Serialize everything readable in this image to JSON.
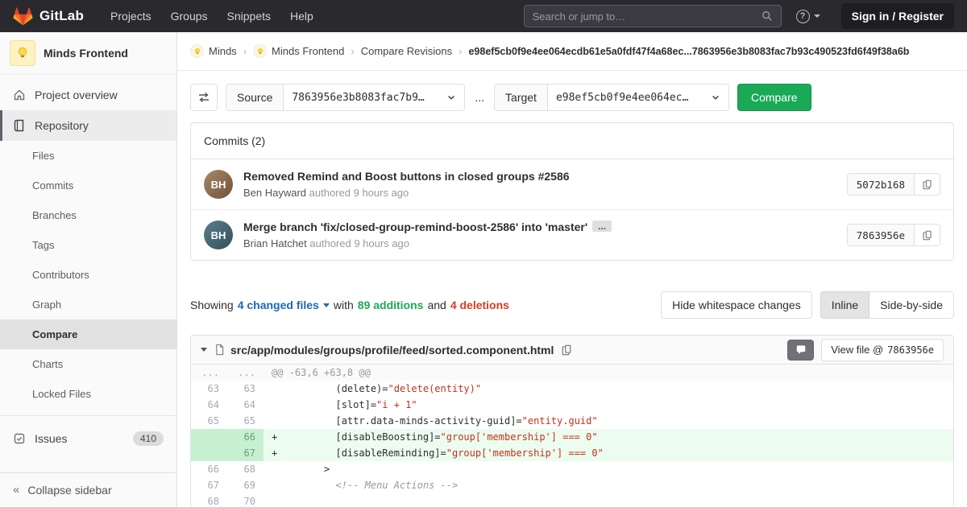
{
  "navbar": {
    "brand": "GitLab",
    "menu": [
      "Projects",
      "Groups",
      "Snippets",
      "Help"
    ],
    "search_placeholder": "Search or jump to…",
    "help_symbol": "?",
    "sign_in": "Sign in / Register"
  },
  "sidebar": {
    "project_name": "Minds Frontend",
    "overview_label": "Project overview",
    "repository_label": "Repository",
    "repo_items": [
      {
        "label": "Files",
        "active": false
      },
      {
        "label": "Commits",
        "active": false
      },
      {
        "label": "Branches",
        "active": false
      },
      {
        "label": "Tags",
        "active": false
      },
      {
        "label": "Contributors",
        "active": false
      },
      {
        "label": "Graph",
        "active": false
      },
      {
        "label": "Compare",
        "active": true
      },
      {
        "label": "Charts",
        "active": false
      },
      {
        "label": "Locked Files",
        "active": false
      }
    ],
    "issues_label": "Issues",
    "issues_count": "410",
    "collapse_label": "Collapse sidebar"
  },
  "breadcrumb": {
    "group": "Minds",
    "project": "Minds Frontend",
    "page": "Compare Revisions",
    "current": "e98ef5cb0f9e4ee064ecdb61e5a0fdf47f4a68ec...7863956e3b8083fac7b93c490523fd6f49f38a6b"
  },
  "compare_form": {
    "source_label": "Source",
    "source_value": "7863956e3b8083fac7b9…",
    "separator": "...",
    "target_label": "Target",
    "target_value": "e98ef5cb0f9e4ee064ec…",
    "compare_button": "Compare"
  },
  "commits": {
    "header": "Commits (2)",
    "items": [
      {
        "title": "Removed Remind and Boost buttons in closed groups #2586",
        "author": "Ben Hayward",
        "authored": "authored 9 hours ago",
        "sha": "5072b168",
        "initials": "BH",
        "expand": ""
      },
      {
        "title": "Merge branch 'fix/closed-group-remind-boost-2586' into 'master'",
        "author": "Brian Hatchet",
        "authored": "authored 9 hours ago",
        "sha": "7863956e",
        "initials": "BH",
        "expand": "..."
      }
    ]
  },
  "summary": {
    "showing": "Showing",
    "changed_files": "4 changed files",
    "with_text": "with",
    "additions": "89 additions",
    "and_text": "and",
    "deletions": "4 deletions",
    "hide_whitespace": "Hide whitespace changes",
    "inline": "Inline",
    "side_by_side": "Side-by-side"
  },
  "diff": {
    "file_path": "src/app/modules/groups/profile/feed/sorted.component.html",
    "view_file_label": "View file @",
    "view_file_sha": "7863956e",
    "lines": [
      {
        "type": "hunk",
        "old": "...",
        "new": "...",
        "segments": [
          {
            "c": "h",
            "t": "@@ -63,6 +63,8 @@"
          }
        ]
      },
      {
        "type": "ctx",
        "old": "63",
        "new": "63",
        "segments": [
          {
            "c": "p",
            "t": "           (delete)="
          },
          {
            "c": "s",
            "t": "\"delete(entity)\""
          }
        ]
      },
      {
        "type": "ctx",
        "old": "64",
        "new": "64",
        "segments": [
          {
            "c": "p",
            "t": "           [slot]="
          },
          {
            "c": "s",
            "t": "\"i + 1\""
          }
        ]
      },
      {
        "type": "ctx",
        "old": "65",
        "new": "65",
        "segments": [
          {
            "c": "p",
            "t": "           [attr.data-minds-activity-guid]="
          },
          {
            "c": "s",
            "t": "\"entity.guid\""
          }
        ]
      },
      {
        "type": "add",
        "old": "",
        "new": "66",
        "segments": [
          {
            "c": "p",
            "t": "+          [disableBoosting]="
          },
          {
            "c": "s",
            "t": "\"group['membership'] === 0\""
          }
        ]
      },
      {
        "type": "add",
        "old": "",
        "new": "67",
        "segments": [
          {
            "c": "p",
            "t": "+          [disableReminding]="
          },
          {
            "c": "s",
            "t": "\"group['membership'] === 0\""
          }
        ]
      },
      {
        "type": "ctx",
        "old": "66",
        "new": "68",
        "segments": [
          {
            "c": "p",
            "t": "         >"
          }
        ]
      },
      {
        "type": "ctx",
        "old": "67",
        "new": "69",
        "segments": [
          {
            "c": "c",
            "t": "           <!-- Menu Actions -->"
          }
        ]
      },
      {
        "type": "ctx",
        "old": "68",
        "new": "70",
        "segments": []
      }
    ]
  },
  "icons": {
    "brand": "gitlab-tanuki-icon",
    "search": "search-icon",
    "help": "question-circle-icon",
    "project_avatar": "lightbulb-icon",
    "overview": "home-icon",
    "repository": "book-icon",
    "issues": "issues-icon",
    "collapse": "double-chevron-left-icon",
    "swap": "swap-arrows-icon",
    "dropdown": "chevron-down-icon",
    "copy": "copy-icon",
    "file": "file-icon",
    "comment": "comment-icon"
  },
  "colors": {
    "navbar_bg": "#29292e",
    "accent_green": "#1aaa55",
    "link_blue": "#1b69b6",
    "danger_red": "#db3b21",
    "addition_bg": "#ecfdf0",
    "addition_gutter": "#c7f0d2"
  }
}
